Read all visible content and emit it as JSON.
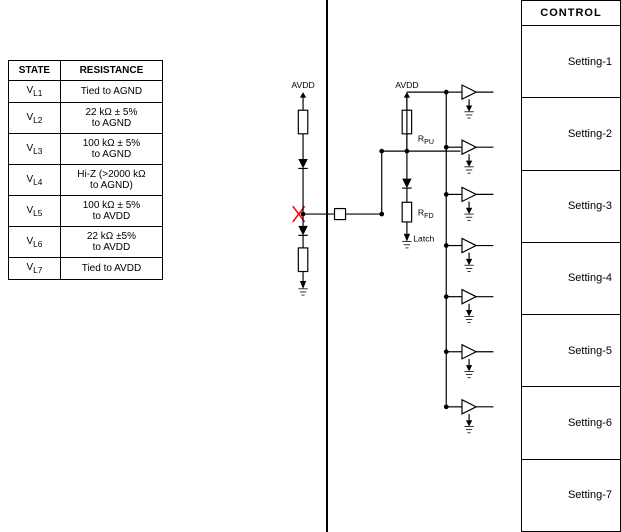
{
  "table": {
    "headers": [
      "STATE",
      "RESISTANCE"
    ],
    "rows": [
      {
        "state": "V",
        "sub": "L1",
        "resistance": "Tied to AGND"
      },
      {
        "state": "V",
        "sub": "L2",
        "resistance": "22 kΩ ± 5%\nto AGND"
      },
      {
        "state": "V",
        "sub": "L3",
        "resistance": "100 kΩ ± 5%\nto AGND"
      },
      {
        "state": "V",
        "sub": "L4",
        "resistance": "Hi-Z (>2000 kΩ\nto AGND)"
      },
      {
        "state": "V",
        "sub": "L5",
        "resistance": "100 kΩ ± 5%\nto AVDD"
      },
      {
        "state": "V",
        "sub": "L6",
        "resistance": "22 kΩ ±5%\nto AVDD"
      },
      {
        "state": "V",
        "sub": "L7",
        "resistance": "Tied to AVDD"
      }
    ]
  },
  "control": {
    "header": "CONTROL",
    "settings": [
      "Setting-1",
      "Setting-2",
      "Setting-3",
      "Setting-4",
      "Setting-5",
      "Setting-6",
      "Setting-7"
    ]
  },
  "circuit": {
    "avdd_left": "AVDD",
    "avdd_right": "AVDD",
    "r_pu": "Rₚᵁ",
    "r_fd": "Rₔ",
    "latch": "Latch"
  }
}
